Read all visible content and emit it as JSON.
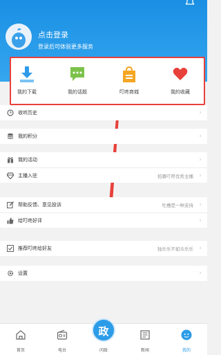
{
  "header": {
    "login_title": "点击登录",
    "login_subtitle": "登录后可体验更多服务"
  },
  "quick_actions": [
    {
      "label": "我的下载",
      "icon": "download-icon",
      "color": "#2e9bea"
    },
    {
      "label": "我的话题",
      "icon": "chat-bubble-icon",
      "color": "#7cc24a"
    },
    {
      "label": "叮咚商城",
      "icon": "shopping-bag-icon",
      "color": "#f5a623"
    },
    {
      "label": "我的收藏",
      "icon": "heart-icon",
      "color": "#e8403a"
    }
  ],
  "menu_groups": [
    [
      {
        "label": "收听历史",
        "right": "",
        "icon": "clock-icon"
      }
    ],
    [
      {
        "label": "我的积分",
        "right": "",
        "icon": "coins-icon"
      }
    ],
    [
      {
        "label": "我的活动",
        "right": "",
        "icon": "gift-icon"
      },
      {
        "label": "主播入驻",
        "right": "招募叮咚优秀主播",
        "icon": "diamond-icon"
      }
    ],
    [
      {
        "label": "帮助反馈、意见投诉",
        "right": "吐槽是一种支持",
        "icon": "edit-icon"
      },
      {
        "label": "给叮咚好评",
        "right": "",
        "icon": "thumbs-up-icon"
      }
    ],
    [
      {
        "label": "推荐叮咚给好友",
        "right": "独乐乐不如众乐乐",
        "icon": "share-icon"
      }
    ],
    [
      {
        "label": "设置",
        "right": "",
        "icon": "gear-icon"
      }
    ]
  ],
  "bottom_nav": {
    "items": [
      {
        "label": "首页",
        "icon": "home-icon"
      },
      {
        "label": "电台",
        "icon": "radio-icon"
      },
      {
        "label": "问政",
        "icon": "ask-icon"
      },
      {
        "label": "新闻",
        "icon": "news-icon"
      },
      {
        "label": "我的",
        "icon": "profile-icon",
        "active": true
      }
    ],
    "center_glyph": "政"
  },
  "colors": {
    "header": "#1a8fe3",
    "highlight": "#e8403a",
    "accent": "#2d9ce8"
  }
}
